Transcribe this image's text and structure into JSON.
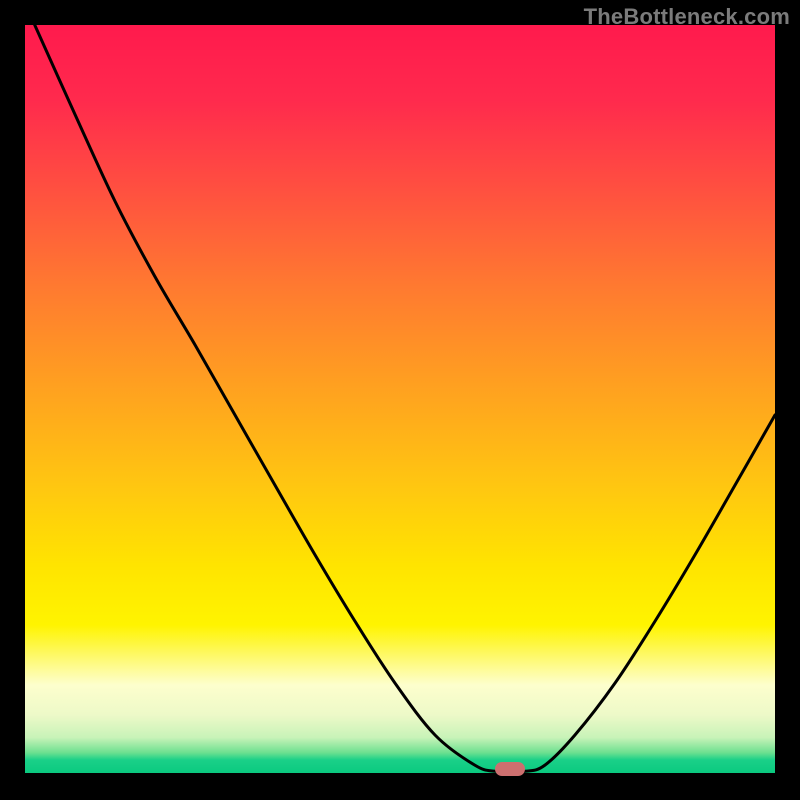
{
  "watermark": "TheBottleneck.com",
  "marker": {
    "x_frac": 0.647,
    "y_frac": 0.992,
    "color": "#cc6f6f"
  },
  "chart_data": {
    "type": "line",
    "title": "",
    "xlabel": "",
    "ylabel": "",
    "xlim": [
      0,
      1
    ],
    "ylim": [
      0,
      1
    ],
    "annotations": [
      "TheBottleneck.com"
    ],
    "marker_x": 0.647,
    "curve": [
      {
        "x": 0.013,
        "y": 1.0
      },
      {
        "x": 0.067,
        "y": 0.88
      },
      {
        "x": 0.12,
        "y": 0.765
      },
      {
        "x": 0.173,
        "y": 0.665
      },
      {
        "x": 0.227,
        "y": 0.573
      },
      {
        "x": 0.28,
        "y": 0.48
      },
      {
        "x": 0.333,
        "y": 0.387
      },
      {
        "x": 0.387,
        "y": 0.293
      },
      {
        "x": 0.44,
        "y": 0.205
      },
      {
        "x": 0.493,
        "y": 0.123
      },
      {
        "x": 0.547,
        "y": 0.053
      },
      {
        "x": 0.6,
        "y": 0.013
      },
      {
        "x": 0.627,
        "y": 0.005
      },
      {
        "x": 0.667,
        "y": 0.005
      },
      {
        "x": 0.693,
        "y": 0.013
      },
      {
        "x": 0.733,
        "y": 0.053
      },
      {
        "x": 0.787,
        "y": 0.123
      },
      {
        "x": 0.84,
        "y": 0.205
      },
      {
        "x": 0.893,
        "y": 0.293
      },
      {
        "x": 0.947,
        "y": 0.387
      },
      {
        "x": 1.0,
        "y": 0.48
      }
    ]
  }
}
